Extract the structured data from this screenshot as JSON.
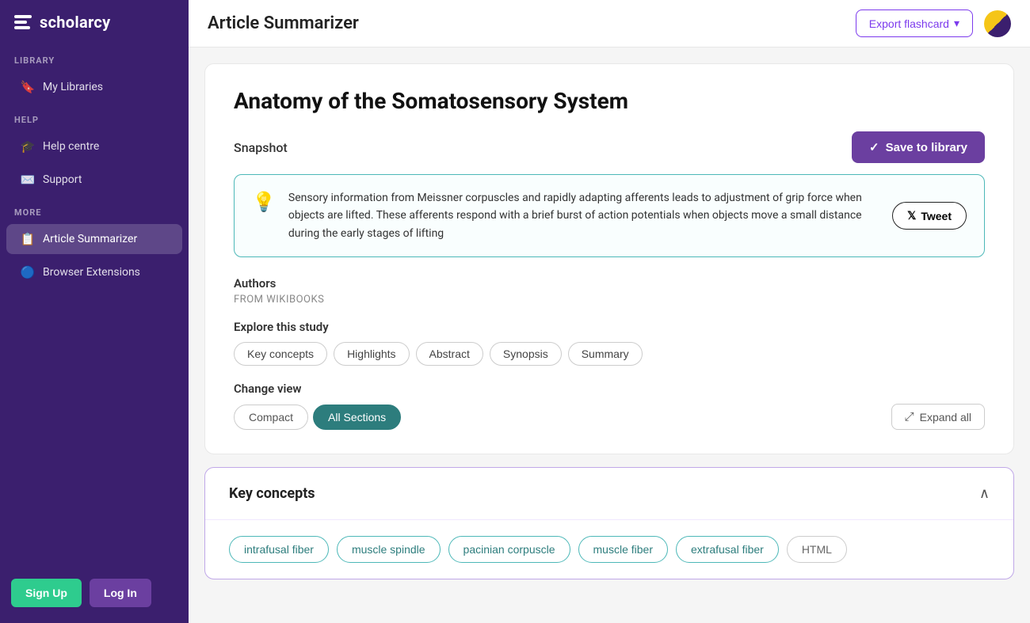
{
  "sidebar": {
    "logo_text": "scholarcy",
    "sections": [
      {
        "label": "LIBRARY",
        "items": [
          {
            "id": "my-libraries",
            "label": "My Libraries",
            "icon": "🔖"
          }
        ]
      },
      {
        "label": "HELP",
        "items": [
          {
            "id": "help-centre",
            "label": "Help centre",
            "icon": "🎓"
          },
          {
            "id": "support",
            "label": "Support",
            "icon": "✉️"
          }
        ]
      },
      {
        "label": "MORE",
        "items": [
          {
            "id": "article-summarizer",
            "label": "Article Summarizer",
            "icon": "📋",
            "active": true
          },
          {
            "id": "browser-extensions",
            "label": "Browser Extensions",
            "icon": "🔵"
          }
        ]
      }
    ],
    "signup_label": "Sign Up",
    "login_label": "Log In"
  },
  "topbar": {
    "title": "Article Summarizer",
    "export_flashcard_label": "Export flashcard",
    "export_chevron": "▾"
  },
  "article": {
    "title": "Anatomy of the Somatosensory System",
    "snapshot_label": "Snapshot",
    "save_to_library_label": "Save to library",
    "snapshot_text": "Sensory information from Meissner corpuscles and rapidly adapting afferents leads to adjustment of grip force when objects are lifted. These afferents respond with a brief burst of action potentials when objects move a small distance during the early stages of lifting",
    "tweet_label": "Tweet",
    "authors_label": "Authors",
    "authors_value": "FROM WIKIBOOKS",
    "explore_label": "Explore this study",
    "explore_tags": [
      "Key concepts",
      "Highlights",
      "Abstract",
      "Synopsis",
      "Summary"
    ],
    "change_view_label": "Change view",
    "view_compact": "Compact",
    "view_all_sections": "All Sections",
    "expand_all_label": "Expand all",
    "key_concepts_title": "Key concepts",
    "concept_tags": [
      "intrafusal fiber",
      "muscle spindle",
      "pacinian corpuscle",
      "muscle fiber",
      "extrafusal fiber",
      "HTML"
    ]
  }
}
